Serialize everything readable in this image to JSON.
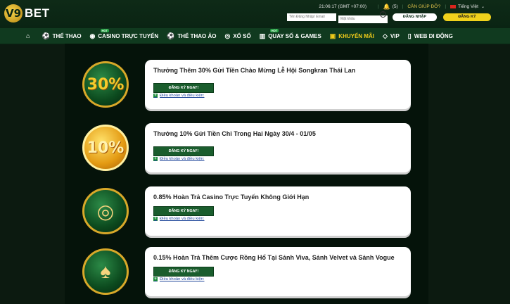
{
  "header": {
    "logo_mark": "V9",
    "logo_text": "BET",
    "clock": "21:06:17 (GMT +07:00)",
    "notifications": "(5)",
    "help": "CẦN GIÚP ĐỠ?",
    "language": "Tiếng Việt",
    "username_placeholder": "Tên Đăng Nhập/ Email",
    "password_placeholder": "Mật khẩu",
    "login_label": "ĐĂNG NHẬP",
    "register_label": "ĐĂNG KÝ"
  },
  "nav": {
    "items": [
      {
        "label": "",
        "icon": "home-icon"
      },
      {
        "label": "THỂ THAO",
        "icon": "soccer-ball-icon"
      },
      {
        "label": "CASINO TRỰC TUYẾN",
        "icon": "casino-chip-icon",
        "badge": "HOT"
      },
      {
        "label": "THỂ THAO ẢO",
        "icon": "virtual-ball-icon"
      },
      {
        "label": "XỔ SỐ",
        "icon": "lottery-icon"
      },
      {
        "label": "QUAY SỐ & GAMES",
        "icon": "slot-icon",
        "badge": "HOT"
      },
      {
        "label": "KHUYẾN MÃI",
        "icon": "gift-icon",
        "active": true
      },
      {
        "label": "VIP",
        "icon": "diamond-icon"
      },
      {
        "label": "WEB DI ĐỘNG",
        "icon": "mobile-icon"
      }
    ]
  },
  "promotions": [
    {
      "title": "Thưởng Thêm 30% Gửi Tiền Chào Mừng Lễ Hội Songkran Thái Lan",
      "badge": "30%",
      "button": "ĐĂNG KÝ NGAY!",
      "terms": "Điều khoản và điều kiện:"
    },
    {
      "title": "Thưởng 10% Gửi Tiền Chỉ Trong Hai Ngày 30/4 - 01/05",
      "badge": "10%",
      "button": "ĐĂNG KÝ NGAY!",
      "terms": "Điều khoản và điều kiện:"
    },
    {
      "title": "0.85% Hoàn Trả Casino Trực Tuyến Không Giới Hạn",
      "badge": "",
      "button": "ĐĂNG KÝ NGAY!",
      "terms": "Điều khoản và điều kiện:"
    },
    {
      "title": "0.15% Hoàn Trả Thêm Cược Rồng Hổ Tại Sảnh Viva, Sảnh Velvet và Sảnh Vogue",
      "badge": "",
      "button": "ĐĂNG KÝ NGAY!",
      "terms": "Điều khoản và điều kiện:"
    }
  ]
}
